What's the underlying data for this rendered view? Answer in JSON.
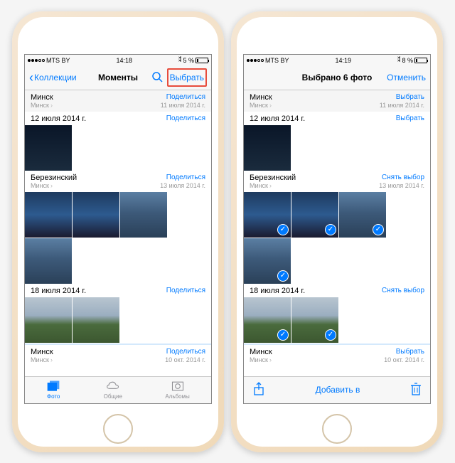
{
  "left": {
    "status": {
      "carrier": "MTS BY",
      "time": "14:18",
      "bt": "✱",
      "battery": "5 %"
    },
    "nav": {
      "back": "Коллекции",
      "title": "Моменты",
      "action": "Выбрать"
    },
    "sections": [
      {
        "title": "Минск",
        "sub": "Минск",
        "action": "Поделиться",
        "date": "11 июля 2014 г."
      },
      {
        "title": "12 июля 2014 г.",
        "sub": "",
        "action": "Поделиться",
        "date": ""
      },
      {
        "title": "Березинский",
        "sub": "Минск",
        "action": "Поделиться",
        "date": "13 июля 2014 г."
      },
      {
        "title": "18 июля 2014 г.",
        "sub": "",
        "action": "Поделиться",
        "date": ""
      },
      {
        "title": "Минск",
        "sub": "Минск",
        "action": "Поделиться",
        "date": "10 окт. 2014 г."
      }
    ],
    "tabs": {
      "photos": "Фото",
      "shared": "Общие",
      "albums": "Альбомы"
    }
  },
  "right": {
    "status": {
      "carrier": "MTS BY",
      "time": "14:19",
      "bt": "✱",
      "battery": "8 %"
    },
    "nav": {
      "title": "Выбрано 6 фото",
      "action": "Отменить"
    },
    "sections": [
      {
        "title": "Минск",
        "sub": "Минск",
        "action": "Выбрать",
        "date": "11 июля 2014 г."
      },
      {
        "title": "12 июля 2014 г.",
        "sub": "",
        "action": "Выбрать",
        "date": ""
      },
      {
        "title": "Березинский",
        "sub": "Минск",
        "action": "Снять выбор",
        "date": "13 июля 2014 г."
      },
      {
        "title": "18 июля 2014 г.",
        "sub": "",
        "action": "Снять выбор",
        "date": ""
      },
      {
        "title": "Минск",
        "sub": "Минск",
        "action": "Выбрать",
        "date": "10 окт. 2014 г."
      }
    ],
    "toolbar": {
      "addto": "Добавить в"
    }
  }
}
